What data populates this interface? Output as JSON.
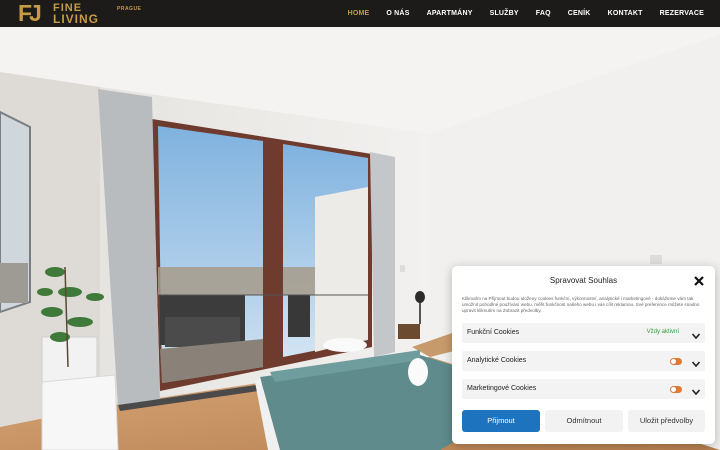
{
  "header": {
    "logo": {
      "initials": "FJ",
      "line1": "FINE",
      "line2": "LIVING",
      "city": "PRAGUE"
    },
    "nav": [
      {
        "label": "HOME",
        "active": true
      },
      {
        "label": "O NÁS",
        "active": false
      },
      {
        "label": "APARTMÁNY",
        "active": false
      },
      {
        "label": "SLUŽBY",
        "active": false
      },
      {
        "label": "FAQ",
        "active": false
      },
      {
        "label": "CENÍK",
        "active": false
      },
      {
        "label": "KONTAKT",
        "active": false
      },
      {
        "label": "REZERVACE",
        "active": false
      }
    ]
  },
  "cookie": {
    "title": "Spravovat Souhlas",
    "text": "Kliknutím na Přijmout budou uloženy cookies funkční, výkonnostní, analytické i marketingové - dokážeme vám tak umožnit pohodlné používání webu, měřit funkčnost našeho webu i vás cílit reklamou. Své preference můžete snadno upravit kliknutím na Zobrazit předvolby.",
    "categories": [
      {
        "label": "Funkční Cookies",
        "status": "Vždy aktivní"
      },
      {
        "label": "Analytické Cookies"
      },
      {
        "label": "Marketingové Cookies"
      }
    ],
    "buttons": {
      "accept": "Přijmout",
      "deny": "Odmítnout",
      "prefs": "Uložit předvolby"
    }
  },
  "colors": {
    "header_bg": "#1d1b1a",
    "brand_gold": "#c79a45",
    "accept_blue": "#1e73be",
    "toggle_orange": "#e07a36",
    "status_green": "#2e9e3a"
  }
}
